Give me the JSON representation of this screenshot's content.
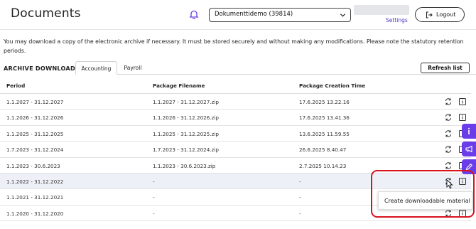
{
  "header": {
    "title": "Documents",
    "company_select": "Dokumenttidemo (39814)",
    "settings_label": "Settings",
    "logout_label": "Logout"
  },
  "intro_text": "You may download a copy of the electronic archive if necessary. It must be stored securely and without making any modifications. Please note the statutory retention periods.",
  "archive": {
    "title": "ARCHIVE DOWNLOAD",
    "tabs": [
      {
        "label": "Accounting",
        "active": true
      },
      {
        "label": "Payroll",
        "active": false
      }
    ],
    "refresh_label": "Refresh list",
    "columns": [
      "Period",
      "Package Filename",
      "Package Creation Time"
    ],
    "rows": [
      {
        "period": "1.1.2027 - 31.12.2027",
        "filename": "1.1.2027 - 31.12.2027.zip",
        "created": "17.6.2025 13.22.16"
      },
      {
        "period": "1.1.2026 - 31.12.2026",
        "filename": "1.1.2026 - 31.12.2026.zip",
        "created": "17.6.2025 13.41.36"
      },
      {
        "period": "1.1.2025 - 31.12.2025",
        "filename": "1.1.2025 - 31.12.2025.zip",
        "created": "13.6.2025 11.59.55"
      },
      {
        "period": "1.7.2023 - 31.12.2024",
        "filename": "1.7.2023 - 31.12.2024.zip",
        "created": "26.6.2025 8.40.47"
      },
      {
        "period": "1.1.2023 - 30.6.2023",
        "filename": "1.1.2023 - 30.6.2023.zip",
        "created": "2.7.2025 10.14.23"
      },
      {
        "period": "1.1.2022 - 31.12.2022",
        "filename": "-",
        "created": "-"
      },
      {
        "period": "1.1.2021 - 31.12.2021",
        "filename": "-",
        "created": "-"
      },
      {
        "period": "1.1.2020 - 31.12.2020",
        "filename": "-",
        "created": "-"
      }
    ]
  },
  "popup": {
    "label": "Create downloadable material"
  },
  "colors": {
    "accent": "#6a3de8",
    "link": "#4d3cc5",
    "highlight_ring": "#d8141f",
    "row_highlight": "#edf0f6"
  },
  "icons": [
    "bell-icon",
    "chevron-down-icon",
    "logout-icon",
    "refresh-icon",
    "info-icon",
    "megaphone-icon",
    "edit-icon",
    "cursor-icon"
  ]
}
